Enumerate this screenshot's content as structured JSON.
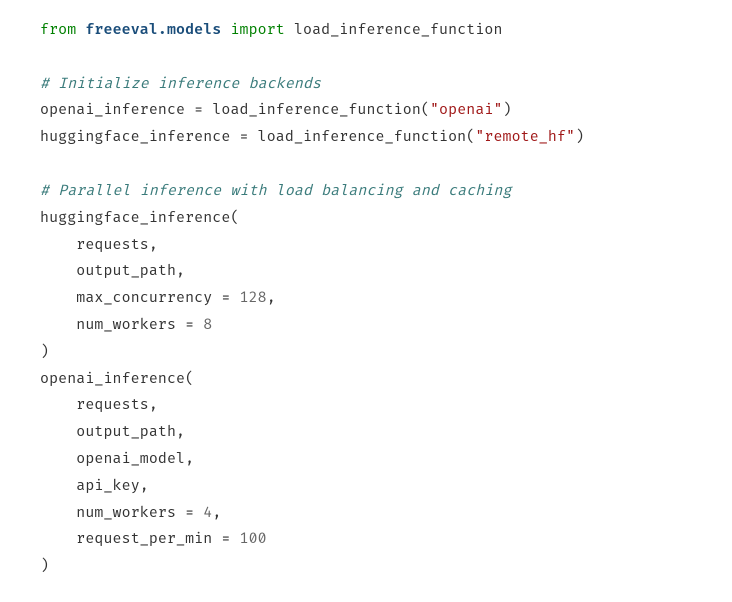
{
  "line1": {
    "from": "from",
    "module": "freeeval.models",
    "import": "import",
    "name": "load_inference_function"
  },
  "comment1": "# Initialize inference backends",
  "line2": {
    "lhs": "openai_inference",
    "func": "load_inference_function",
    "arg": "\"openai\""
  },
  "line3": {
    "lhs": "huggingface_inference",
    "func": "load_inference_function",
    "arg": "\"remote_hf\""
  },
  "comment2": "# Parallel inference with load balancing and caching",
  "call1": {
    "name": "huggingface_inference",
    "arg1": "requests",
    "arg2": "output_path",
    "arg3_key": "max_concurrency",
    "arg3_val": "128",
    "arg4_key": "num_workers",
    "arg4_val": "8"
  },
  "call2": {
    "name": "openai_inference",
    "arg1": "requests",
    "arg2": "output_path",
    "arg3": "openai_model",
    "arg4": "api_key",
    "arg5_key": "num_workers",
    "arg5_val": "4",
    "arg6_key": "request_per_min",
    "arg6_val": "100"
  }
}
